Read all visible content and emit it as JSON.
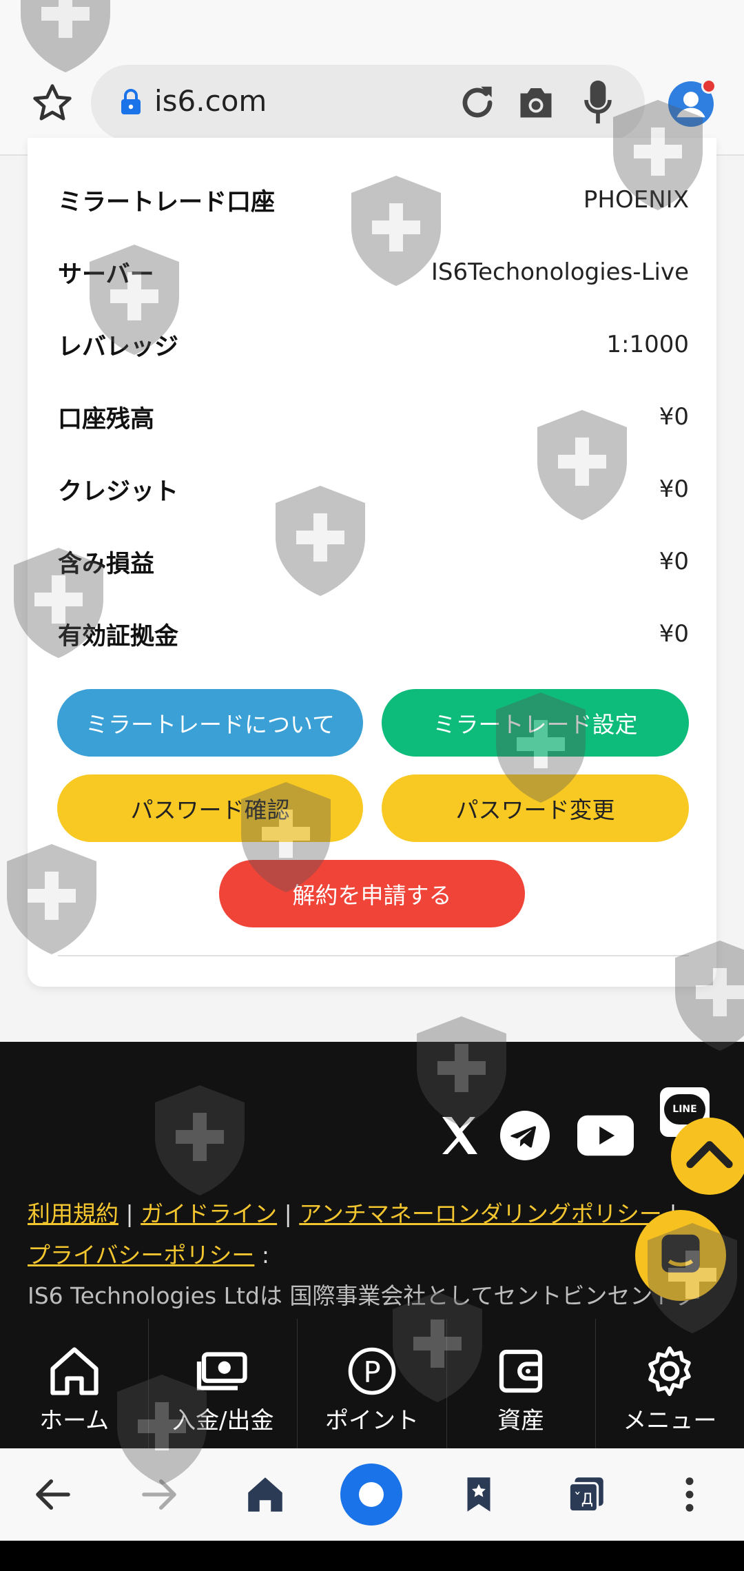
{
  "browser": {
    "url": "is6.com",
    "icons": [
      "star-icon",
      "lock-icon",
      "reload-icon",
      "camera-icon",
      "mic-icon",
      "profile-icon"
    ]
  },
  "account": {
    "rows": [
      {
        "label": "ミラートレード口座",
        "value": "PHOENIX"
      },
      {
        "label": "サーバー",
        "value": "IS6Techonologies-Live"
      },
      {
        "label": "レバレッジ",
        "value": "1:1000"
      },
      {
        "label": "口座残高",
        "value": "¥0"
      },
      {
        "label": "クレジット",
        "value": "¥0"
      },
      {
        "label": "含み損益",
        "value": "¥0"
      },
      {
        "label": "有効証拠金",
        "value": "¥0"
      }
    ],
    "buttons": {
      "about": "ミラートレードについて",
      "settings": "ミラートレード設定",
      "password_confirm": "パスワード確認",
      "password_change": "パスワード変更",
      "cancel_request": "解約を申請する"
    },
    "colors": {
      "about": "#3aa0d6",
      "settings": "#0dbb7a",
      "password": "#f9c923",
      "cancel": "#f04438"
    }
  },
  "footer": {
    "social_icons": [
      "x-icon",
      "telegram-icon",
      "youtube-icon",
      "line-icon"
    ],
    "line_text": "LINE",
    "links": [
      "利用規約",
      "ガイドライン",
      "アンチマネーロンダリングポリシー",
      "プライバシーポリシー"
    ],
    "separator": "|",
    "after_links": " :",
    "company_text": "IS6 Technologies Ltdは 国際事業会社としてセントビンセントグ",
    "bg": "#121212",
    "link_color": "#f3c52f"
  },
  "bottom_nav": {
    "items": [
      {
        "label": "ホーム",
        "icon": "home-icon"
      },
      {
        "label": "入金/出金",
        "icon": "cash-icon"
      },
      {
        "label": "ポイント",
        "icon": "point-icon"
      },
      {
        "label": "資産",
        "icon": "wallet-icon"
      },
      {
        "label": "メニュー",
        "icon": "gear-icon"
      }
    ]
  },
  "browser_bottom": {
    "icons": [
      "back-icon",
      "forward-icon",
      "home-icon",
      "record-icon",
      "bookmarks-icon",
      "translate-icon",
      "more-icon"
    ]
  }
}
